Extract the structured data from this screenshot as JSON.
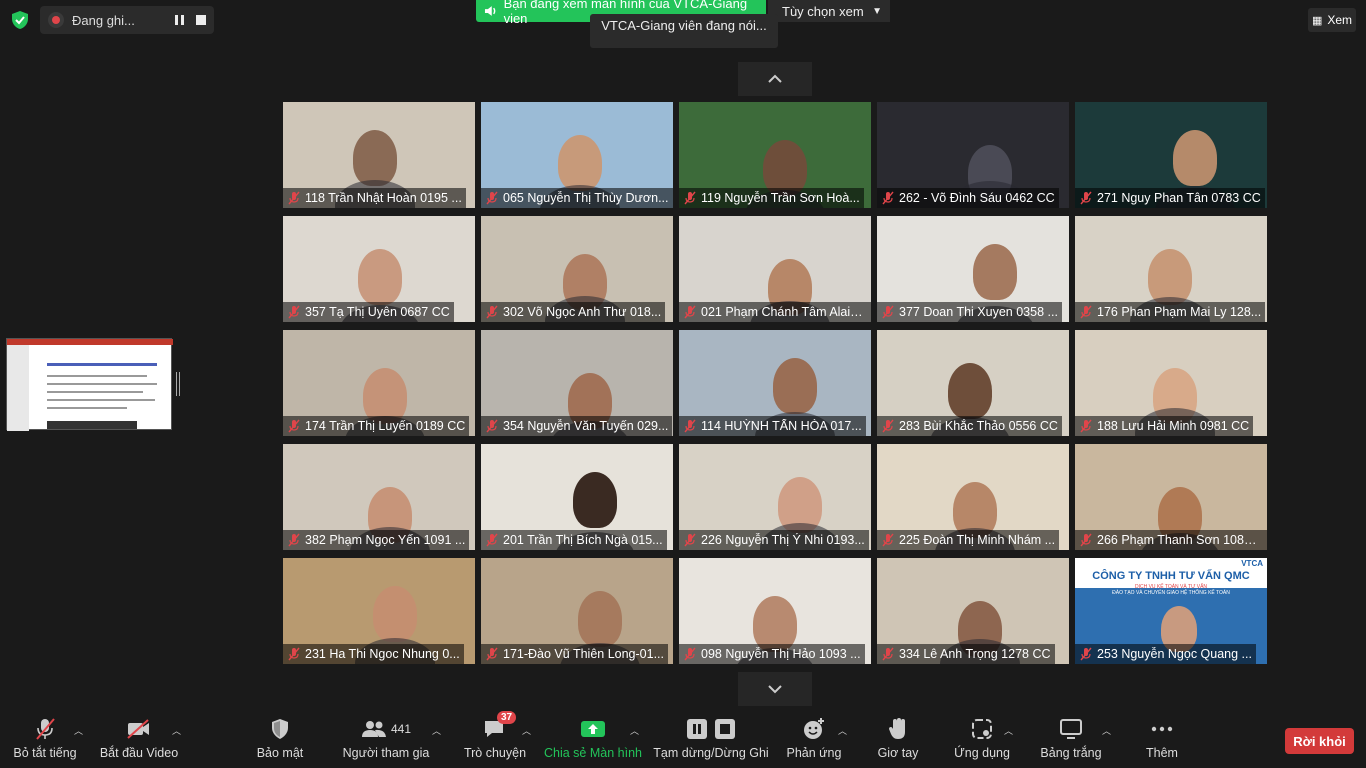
{
  "recording": {
    "label": "Đang ghi..."
  },
  "share_banner": {
    "text": "Bạn đang xem màn hình của VTCA-Giang vien"
  },
  "view_options": {
    "label": "Tùy chọn xem"
  },
  "speaker_tip": {
    "text": "VTCA-Giang viên đang nói..."
  },
  "view_button": {
    "label": "Xem"
  },
  "participants": [
    {
      "name": "118 Trần Nhật Hoàn 0195 ...",
      "bg": "#cfc6b8",
      "face": "#8a6a55"
    },
    {
      "name": "065 Nguyễn Thị Thùy Dươn...",
      "bg": "#9bbbd6",
      "face": "#c79a7a"
    },
    {
      "name": "119 Nguyễn Trần Sơn Hoà...",
      "bg": "#3d6b3a",
      "face": "#6e4e3a"
    },
    {
      "name": "262 - Võ Đình Sáu 0462 CC",
      "bg": "#2a2a30",
      "face": "#4a4a55"
    },
    {
      "name": "271 Nguy Phan Tân 0783 CC",
      "bg": "#1c3a3a",
      "face": "#b58a6a"
    },
    {
      "name": "357 Tạ Thị Uyên 0687 CC",
      "bg": "#ddd8d0",
      "face": "#c99a80"
    },
    {
      "name": "302 Võ Ngọc Anh Thư 018...",
      "bg": "#c8c0b2",
      "face": "#b08065"
    },
    {
      "name": "021 Phạm Chánh Tâm Alain...",
      "bg": "#d8d4ce",
      "face": "#b78768"
    },
    {
      "name": "377 Doan Thi Xuyen 0358 ...",
      "bg": "#e4e2dd",
      "face": "#a57a60"
    },
    {
      "name": "176 Phan Phạm Mai Ly 128...",
      "bg": "#d8d2c6",
      "face": "#c89a7a"
    },
    {
      "name": "174 Trần Thị Luyến 0189 CC",
      "bg": "#bfb6a8",
      "face": "#c59378"
    },
    {
      "name": "354 Nguyễn Văn Tuyến 029...",
      "bg": "#b8b4ad",
      "face": "#a27258"
    },
    {
      "name": "114 HUỲNH TẤN HÒA 017...",
      "bg": "#a9b6c2",
      "face": "#9a6e55"
    },
    {
      "name": "283 Bùi Khắc Thảo 0556 CC",
      "bg": "#d6d0c4",
      "face": "#6e4e3a"
    },
    {
      "name": "188 Lưu Hải Minh 0981 CC",
      "bg": "#d8cfc0",
      "face": "#d8aa8a"
    },
    {
      "name": "382 Phạm Ngọc Yến 1091 ...",
      "bg": "#d0c8bc",
      "face": "#c7957a"
    },
    {
      "name": "201 Trần Thị Bích Ngà 015...",
      "bg": "#e6e2da",
      "face": "#3a2a22"
    },
    {
      "name": "226 Nguyễn Thị Ý Nhi 0193...",
      "bg": "#d8d2c6",
      "face": "#d0a088"
    },
    {
      "name": "225 Đoàn Thị Minh Nhám ...",
      "bg": "#e2d8c6",
      "face": "#b78768"
    },
    {
      "name": "266 Phạm Thanh Sơn 1082 ...",
      "bg": "#c9b79e",
      "face": "#b07a55"
    },
    {
      "name": "231 Ha Thi Ngoc Nhung 0...",
      "bg": "#b89a70",
      "face": "#c48f70"
    },
    {
      "name": "171-Đào Vũ Thiên Long-01...",
      "bg": "#b8a48a",
      "face": "#a67a5e"
    },
    {
      "name": "098 Nguyễn Thị Hảo 1093 ...",
      "bg": "#e8e4de",
      "face": "#b88a70"
    },
    {
      "name": "334 Lê Anh Trọng 1278 CC",
      "bg": "#cfc5b5",
      "face": "#8e6650"
    },
    {
      "name": "253 Nguyễn Ngọc Quang ...",
      "bg": "#2e6fb0",
      "face": "#c89a80"
    }
  ],
  "qmc_slide": {
    "title": "CÔNG TY TNHH TƯ VẤN QMC",
    "subtitle": "DỊCH VỤ KẾ TOÁN VÀ TƯ VẤN",
    "subtitle2": "ĐÀO TẠO VÀ CHUYỂN GIAO HỆ THỐNG KẾ TOÁN",
    "logo": "VTCA"
  },
  "thumbnail": {
    "title": "Tính thuế và TLTC và nhân sự lớn"
  },
  "toolbar": {
    "mute": "Bỏ tắt tiếng",
    "video": "Bắt đầu Video",
    "security": "Bảo mật",
    "participants": "Người tham gia",
    "participants_count": "441",
    "chat": "Trò chuyện",
    "chat_badge": "37",
    "share": "Chia sẻ Màn hình",
    "pause": "Tạm dừng/Dừng Ghi",
    "reactions": "Phản ứng",
    "raise_hand": "Giơ tay",
    "apps": "Ứng dụng",
    "whiteboard": "Bảng trắng",
    "more": "Thêm",
    "leave": "Rời khỏi"
  },
  "colors": {
    "accent_green": "#23c45a",
    "leave_red": "#d33a3a",
    "background": "#1a1a1a"
  }
}
